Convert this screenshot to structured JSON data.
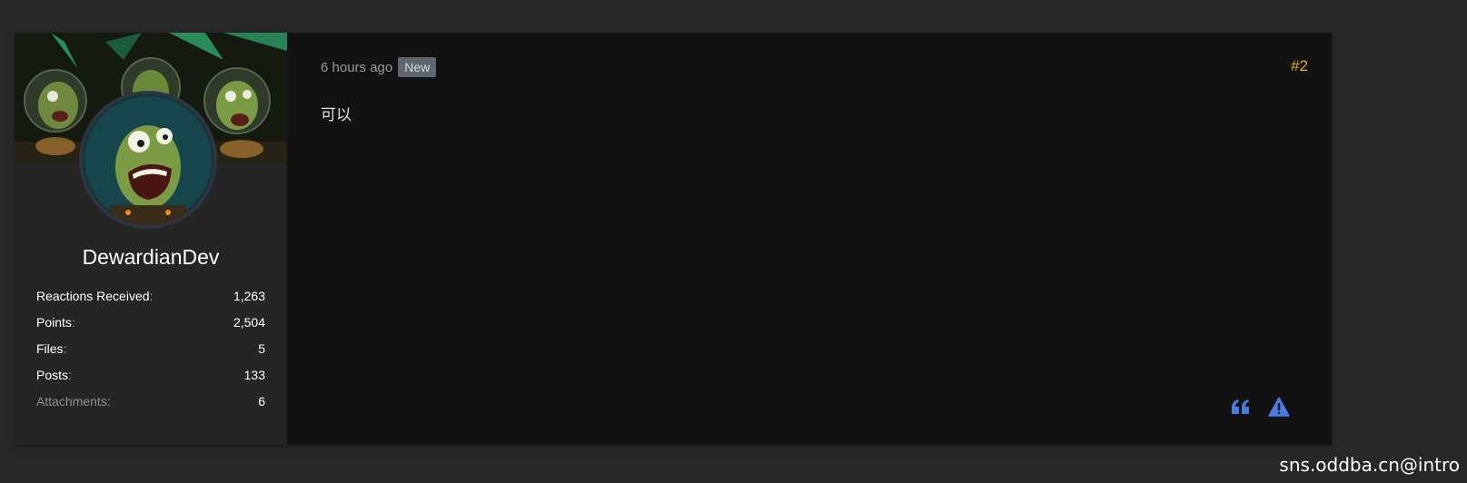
{
  "post": {
    "timestamp": "6 hours ago",
    "badge": "New",
    "number": "#2",
    "body": "可以",
    "author": {
      "username": "DewardianDev",
      "stats": [
        {
          "label": "Reactions Received",
          "value": "1,263"
        },
        {
          "label": "Points",
          "value": "2,504"
        },
        {
          "label": "Files",
          "value": "5"
        },
        {
          "label": "Posts",
          "value": "133"
        },
        {
          "label": "Attachments",
          "value": "6"
        }
      ]
    },
    "actions": {
      "quote_icon": "quote-icon",
      "report_icon": "warning-icon"
    }
  },
  "watermark": "sns.oddba.cn@intro",
  "colors": {
    "accent": "#f0a81c",
    "action_blue": "#4a7ae0",
    "badge_bg": "#5f6670"
  }
}
